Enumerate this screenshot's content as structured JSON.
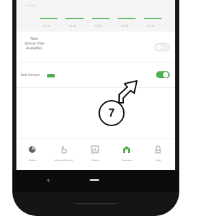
{
  "chart": {
    "x_ticks": [
      "07:30",
      "07:35",
      "07:37",
      "07:38",
      "07:39"
    ]
  },
  "settings": {
    "rain_sensor": {
      "label_lines": [
        "Rain",
        "Sensor (Not",
        "Available)"
      ],
      "enabled": false
    },
    "soil_sensor": {
      "label": "Soil Sensor",
      "enabled": true
    }
  },
  "annotation": {
    "step_number": "7"
  },
  "nav": {
    "items": [
      {
        "label": "Status",
        "icon": "status-icon"
      },
      {
        "label": "Manual Control",
        "icon": "hand-icon"
      },
      {
        "label": "Charts",
        "icon": "chart-icon"
      },
      {
        "label": "Sensors",
        "icon": "sensor-icon",
        "active": true
      },
      {
        "label": "Help",
        "icon": "help-icon"
      }
    ]
  },
  "colors": {
    "accent": "#4caf50",
    "chart_line": "#5fba6a"
  }
}
